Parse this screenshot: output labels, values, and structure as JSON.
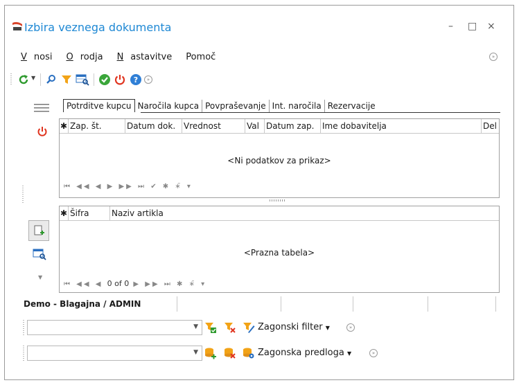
{
  "window": {
    "title": "Izbira veznega dokumenta",
    "minimize": "–",
    "maximize": "□",
    "close": "×"
  },
  "menu": {
    "items": [
      {
        "label": "Vnosi"
      },
      {
        "label": "Orodja"
      },
      {
        "label": "Nastavitve"
      },
      {
        "label": "Pomoč"
      }
    ]
  },
  "tabs": [
    {
      "label": "Potrditve kupcu"
    },
    {
      "label": "Naročila kupca"
    },
    {
      "label": "Povpraševanje"
    },
    {
      "label": "Int. naročila"
    },
    {
      "label": "Rezervacije"
    }
  ],
  "top_grid": {
    "columns": [
      "Zap. št.",
      "Datum dok.",
      "Vrednost",
      "Val",
      "Datum zap.",
      "Ime dobavitelja",
      "Del"
    ],
    "empty_text": "<Ni podatkov za prikaz>",
    "nav": "⏮ ◀◀ ◀ ▶ ▶▶ ⏭ ✔ ✱ ∗̄ ▾"
  },
  "bottom_grid": {
    "columns": [
      "Šifra",
      "Naziv artikla"
    ],
    "empty_text": "<Prazna tabela>",
    "nav_prefix": "⏮ ◀◀ ◀",
    "record": "0 of 0",
    "nav_suffix": "▶ ▶▶ ⏭ ✱ ∗̄ ▾"
  },
  "status": {
    "text": "Demo - Blagajna / ADMIN"
  },
  "filter": {
    "label": "Zagonski filter",
    "value": ""
  },
  "template": {
    "label": "Zagonska predloga",
    "value": ""
  },
  "colors": {
    "accent": "#1e88d4",
    "green": "#3aa63a",
    "red": "#e0341f",
    "orange": "#f0a020"
  }
}
